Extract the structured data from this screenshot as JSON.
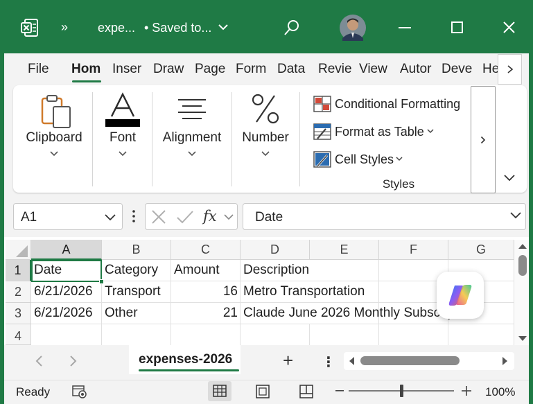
{
  "title_bar": {
    "overflow_label": "»",
    "file_name": "expe...",
    "save_status": "• Saved to...",
    "chevron": "⌄"
  },
  "ribbon_tabs": [
    "File",
    "Hom",
    "Inser",
    "Draw",
    "Page",
    "Form",
    "Data",
    "Revie",
    "View",
    "Autor",
    "Deve",
    "He"
  ],
  "ribbon_groups": {
    "clipboard": "Clipboard",
    "font": "Font",
    "alignment": "Alignment",
    "number": "Number",
    "styles": "Styles"
  },
  "styles_items": {
    "conditional_formatting": "Conditional Formatting",
    "format_as_table": "Format as Table",
    "cell_styles": "Cell Styles"
  },
  "formula_bar": {
    "name_box": "A1",
    "fx_label": "fx",
    "formula_value": "Date"
  },
  "grid": {
    "columns": [
      "A",
      "B",
      "C",
      "D",
      "E",
      "F",
      "G"
    ],
    "rows": [
      "1",
      "2",
      "3",
      "4"
    ],
    "cells": [
      [
        "Date",
        "Category",
        "Amount",
        "Description"
      ],
      [
        "6/21/2026",
        "Transport",
        "16",
        "Metro Transportation"
      ],
      [
        "6/21/2026",
        "Other",
        "21",
        "Claude June 2026 Monthly Subscription"
      ],
      [
        "",
        "",
        "",
        ""
      ]
    ]
  },
  "sheet_tabs": {
    "active_sheet": "expenses-2026",
    "add_label": "+",
    "more_label": "⋮"
  },
  "status_bar": {
    "status": "Ready",
    "zoom": "100%"
  },
  "colors": {
    "accent": "#1f7a45",
    "chrome": "#f3f3f3"
  },
  "icons": [
    "excel-app-icon",
    "search-icon",
    "user-avatar",
    "minimize-icon",
    "maximize-icon",
    "close-icon",
    "clipboard-icon",
    "font-icon",
    "alignment-icon",
    "percent-icon",
    "conditional-formatting-icon",
    "format-as-table-icon",
    "cell-styles-icon",
    "copilot-icon",
    "accessibility-icon",
    "normal-view-icon",
    "page-layout-icon",
    "page-break-icon"
  ]
}
